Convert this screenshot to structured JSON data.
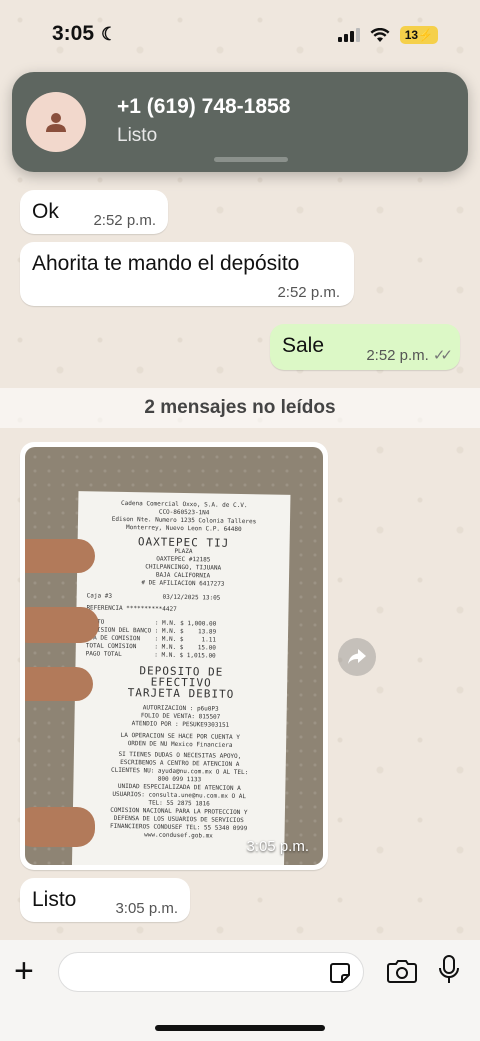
{
  "status_bar": {
    "time": "3:05",
    "battery": "13"
  },
  "notification": {
    "contact": "+1 (619) 748-1858",
    "message": "Listo"
  },
  "messages": [
    {
      "text": "Ok",
      "time": "2:52 p.m."
    },
    {
      "text": "Ahorita te mando el depósito",
      "time": "2:52 p.m."
    },
    {
      "text": "Sale",
      "time": "2:52 p.m.",
      "ticks": "✓✓"
    }
  ],
  "unread_label": "2 mensajes no leídos",
  "photo_message": {
    "time": "3:05 p.m.",
    "receipt": {
      "header1": "Cadena Comercial Oxxo, S.A. de C.V.",
      "header2": "CCO-860523-1N4",
      "header3": "Edison Nte. Numero 1235 Colonia Talleres",
      "header4": "Monterrey, Nuevo Leon C.P. 64480",
      "store": "OAXTEPEC TIJ",
      "store_sub1": "PLAZA",
      "store_sub2": "OAXTEPEC #12185",
      "store_sub3": "CHILPANCINGO, TIJUANA",
      "store_sub4": "BAJA CALIFORNIA",
      "store_sub5": "# DE AFILIACION 6417273",
      "caja": "Caja #3              03/12/2025 13:05",
      "referencia": "REFERENCIA **********4427",
      "monto": "MONTO              : M.N. $ 1,000.00",
      "comision": "COMISION DEL BANCO : M.N. $    13.89",
      "iva": "IVA DE COMISION    : M.N. $     1.11",
      "total_comision": "TOTAL COMISION     : M.N. $    15.00",
      "pago_total": "PAGO TOTAL         : M.N. $ 1,015.00",
      "deposit_title1": "DEPOSITO DE",
      "deposit_title2": "EFECTIVO",
      "deposit_title3": "TARJETA DEBITO",
      "autorizacion": "AUTORIZACION : p6u0P3",
      "folio": "FOLIO DE VENTA: 815507",
      "atendio": "ATENDIO POR : PESUKE9303151",
      "footer1": "LA OPERACION SE HACE POR CUENTA Y",
      "footer2": "ORDEN DE NU Mexico Financiera",
      "footer3": "SI TIENES DUDAS O NECESITAS APOYO,",
      "footer4": "ESCRIBENOS A CENTRO DE ATENCION A",
      "footer5": "CLIENTES NU: ayuda@nu.com.mx O AL TEL:",
      "footer6": "800 099 1133",
      "footer7": "UNIDAD ESPECIALIZADA DE ATENCION A",
      "footer8": "USUARIOS: consulta.une@nu.com.mx O AL",
      "footer9": "TEL: 55 2875 1816",
      "footer10": "COMISION NACIONAL PARA LA PROTECCION Y",
      "footer11": "DEFENSA DE LOS USUARIOS DE SERVICIOS",
      "footer12": "FINANCIEROS CONDUSEF TEL: 55 5340 0999",
      "footer13": "www.condusef.gob.mx"
    }
  },
  "last_message": {
    "text": "Listo",
    "time": "3:05 p.m."
  },
  "composer": {
    "placeholder": ""
  },
  "icons": {
    "avatar": "person-icon",
    "forward": "forward-icon",
    "plus": "plus-icon",
    "sticker": "sticker-icon",
    "camera": "camera-icon",
    "mic": "microphone-icon"
  }
}
